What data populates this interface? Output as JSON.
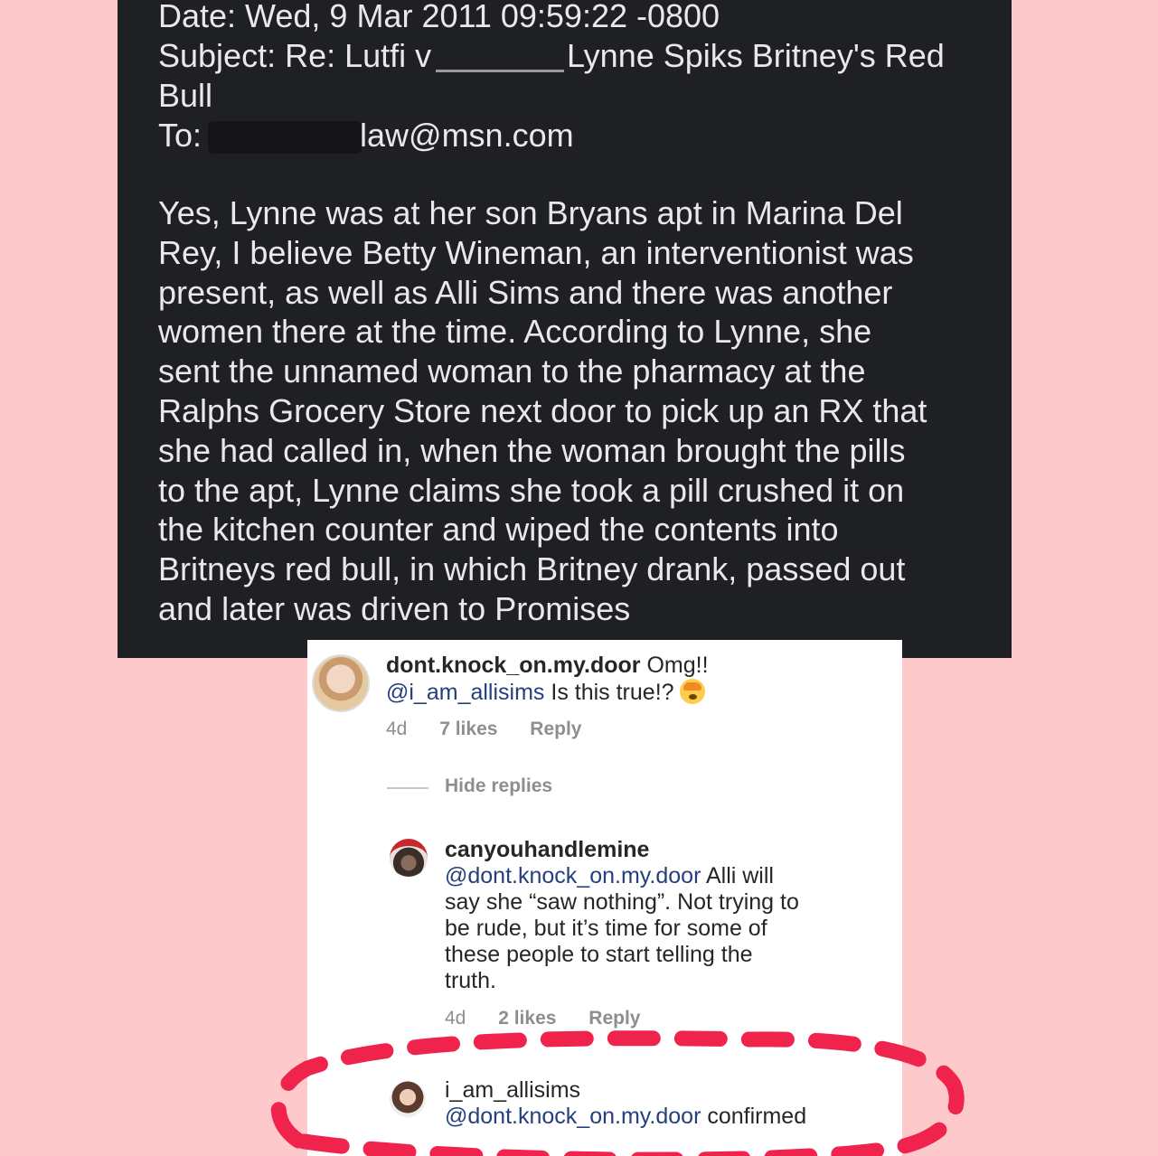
{
  "email": {
    "date_line": "Date: Wed, 9 Mar 2011 09:59:22 -0800",
    "subject_prefix": "Subject: Re: Lutfi v",
    "subject_suffix": "Lynne Spiks Britney's Red",
    "subject_line2": "Bull",
    "to_prefix": "To:",
    "to_suffix": "law@msn.com",
    "body_lines": [
      "Yes, Lynne was at her son Bryans apt in Marina Del",
      "Rey,  I believe Betty Wineman, an interventionist was",
      "present, as well as Alli Sims and there was another",
      "women there at the time.  According to Lynne, she",
      "sent the unnamed woman to the pharmacy at the",
      "Ralphs Grocery Store next door to pick up an RX that",
      "she had called in, when the woman brought the pills",
      "to the apt, Lynne claims she took a pill crushed it on",
      "the kitchen counter and wiped the contents into",
      "Britneys red bull, in which Britney drank, passed out",
      "and later was driven to Promises"
    ]
  },
  "comments": {
    "comment1": {
      "username": "dont.knock_on.my.door",
      "text1": " Omg!!",
      "mention": "@i_am_allisims",
      "text2": " Is this true!? ",
      "age": "4d",
      "likes": "7 likes",
      "reply": "Reply"
    },
    "hide_replies": "Hide replies",
    "reply1": {
      "username": "canyouhandlemine",
      "mention": "@dont.knock_on.my.door",
      "line1": " Alli will",
      "line2": "say she “saw nothing”. Not trying to",
      "line3": "be rude, but it’s time for some of",
      "line4": "these people to start telling the",
      "line5": "truth.",
      "age": "4d",
      "likes": "2 likes",
      "reply": "Reply"
    },
    "reply2": {
      "username": "i_am_allisims",
      "mention": "@dont.knock_on.my.door",
      "text": " confirmed"
    }
  },
  "colors": {
    "background": "#fdc9cb",
    "email_panel": "#1f2023",
    "mention_blue": "#253f7e",
    "highlight_red": "#f0234c"
  }
}
